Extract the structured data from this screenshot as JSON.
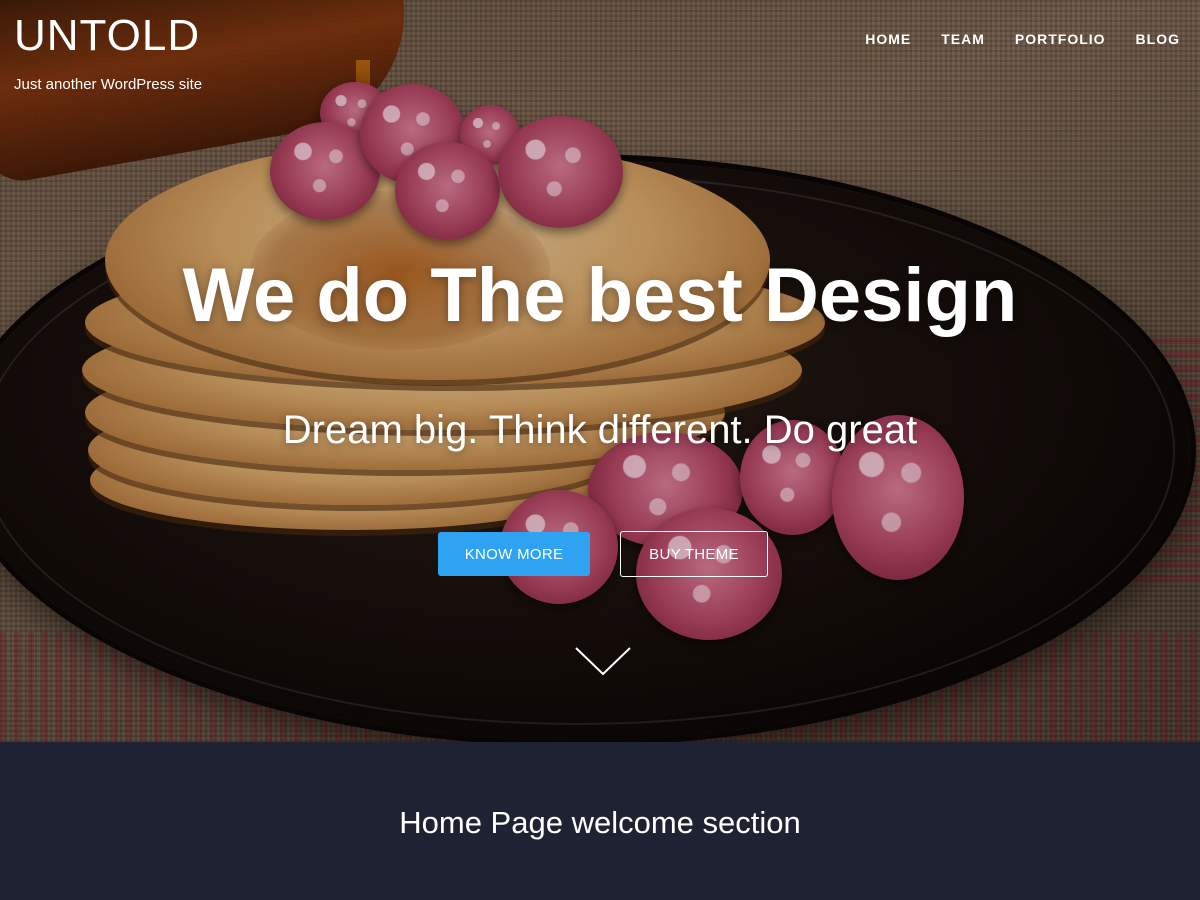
{
  "site": {
    "title": "UNTOLD",
    "tagline": "Just another WordPress site"
  },
  "nav": {
    "items": [
      {
        "label": "HOME"
      },
      {
        "label": "TEAM"
      },
      {
        "label": "PORTFOLIO"
      },
      {
        "label": "BLOG"
      }
    ]
  },
  "hero": {
    "headline": "We do The best Design",
    "subline": "Dream big. Think different. Do great",
    "primary_button": "KNOW MORE",
    "secondary_button": "BUY THEME",
    "scroll_icon": "chevron-down-icon"
  },
  "welcome": {
    "heading": "Home Page welcome section"
  },
  "colors": {
    "accent": "#2ea3f2",
    "section_bg": "#1f2232",
    "text": "#ffffff"
  }
}
